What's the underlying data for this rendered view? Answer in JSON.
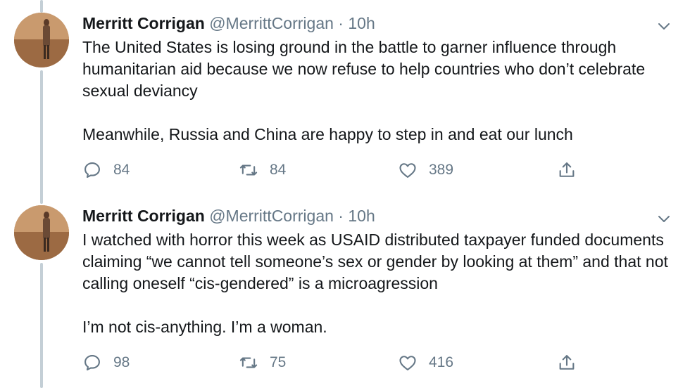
{
  "tweets": [
    {
      "name": "Merritt Corrigan",
      "handle": "@MerrittCorrigan",
      "separator": "·",
      "time": "10h",
      "paragraphs": [
        "The United States is losing ground in the battle to garner influence through humanitarian aid because we now refuse to help countries who don’t celebrate sexual deviancy",
        "Meanwhile, Russia and China are happy to step in and eat our lunch"
      ],
      "replies": "84",
      "retweets": "84",
      "likes": "389"
    },
    {
      "name": "Merritt Corrigan",
      "handle": "@MerrittCorrigan",
      "separator": "·",
      "time": "10h",
      "paragraphs": [
        "I watched with horror this week as USAID distributed taxpayer funded documents claiming “we cannot tell someone’s sex or gender by looking at them” and that not calling oneself “cis-gendered” is a microagression",
        "I’m not cis-anything. I’m a woman."
      ],
      "replies": "98",
      "retweets": "75",
      "likes": "416"
    }
  ],
  "icons": {
    "reply": "reply-icon",
    "retweet": "retweet-icon",
    "like": "heart-icon",
    "share": "share-icon",
    "menu": "chevron-down-icon"
  },
  "colors": {
    "text": "#14171a",
    "secondary": "#657786",
    "thread_line": "#c4cfd6"
  }
}
